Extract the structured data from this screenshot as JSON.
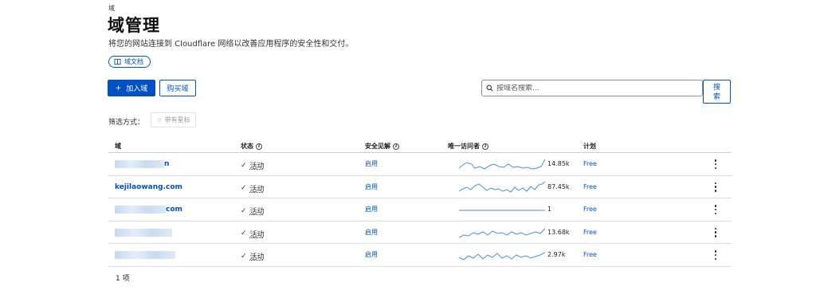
{
  "header": {
    "breadcrumb": "域",
    "title": "域管理",
    "subtitle": "将您的网站连接到 Cloudflare 网络以改善应用程序的安全性和交付。",
    "doc_link": "域文档"
  },
  "actions": {
    "add_label": "加入域",
    "buy_label": "购买域",
    "search_placeholder": "按域名搜索...",
    "search_button": "搜索"
  },
  "filter": {
    "label": "筛选方式：",
    "starred": "带有星标"
  },
  "table": {
    "columns": {
      "domain": "域",
      "status": "状态",
      "insights": "安全见解",
      "visitors": "唯一访问者",
      "plan": "计划"
    },
    "rows": [
      {
        "domain_visible": "n",
        "status": "活动",
        "insight": "启用",
        "visitors": "14.85k",
        "plan": "Free"
      },
      {
        "domain_visible": "kejilaowang.com",
        "status": "活动",
        "insight": "启用",
        "visitors": "87.45k",
        "plan": "Free"
      },
      {
        "domain_visible": "com",
        "status": "活动",
        "insight": "启用",
        "visitors": "1",
        "plan": "Free"
      },
      {
        "domain_visible": "",
        "status": "活动",
        "insight": "启用",
        "visitors": "13.68k",
        "plan": "Free"
      },
      {
        "domain_visible": "",
        "status": "活动",
        "insight": "启用",
        "visitors": "2.97k",
        "plan": "Free"
      }
    ]
  },
  "footer": {
    "count": "1 项"
  },
  "colors": {
    "accent": "#0051c3",
    "sparkline": "#4a90d9"
  }
}
